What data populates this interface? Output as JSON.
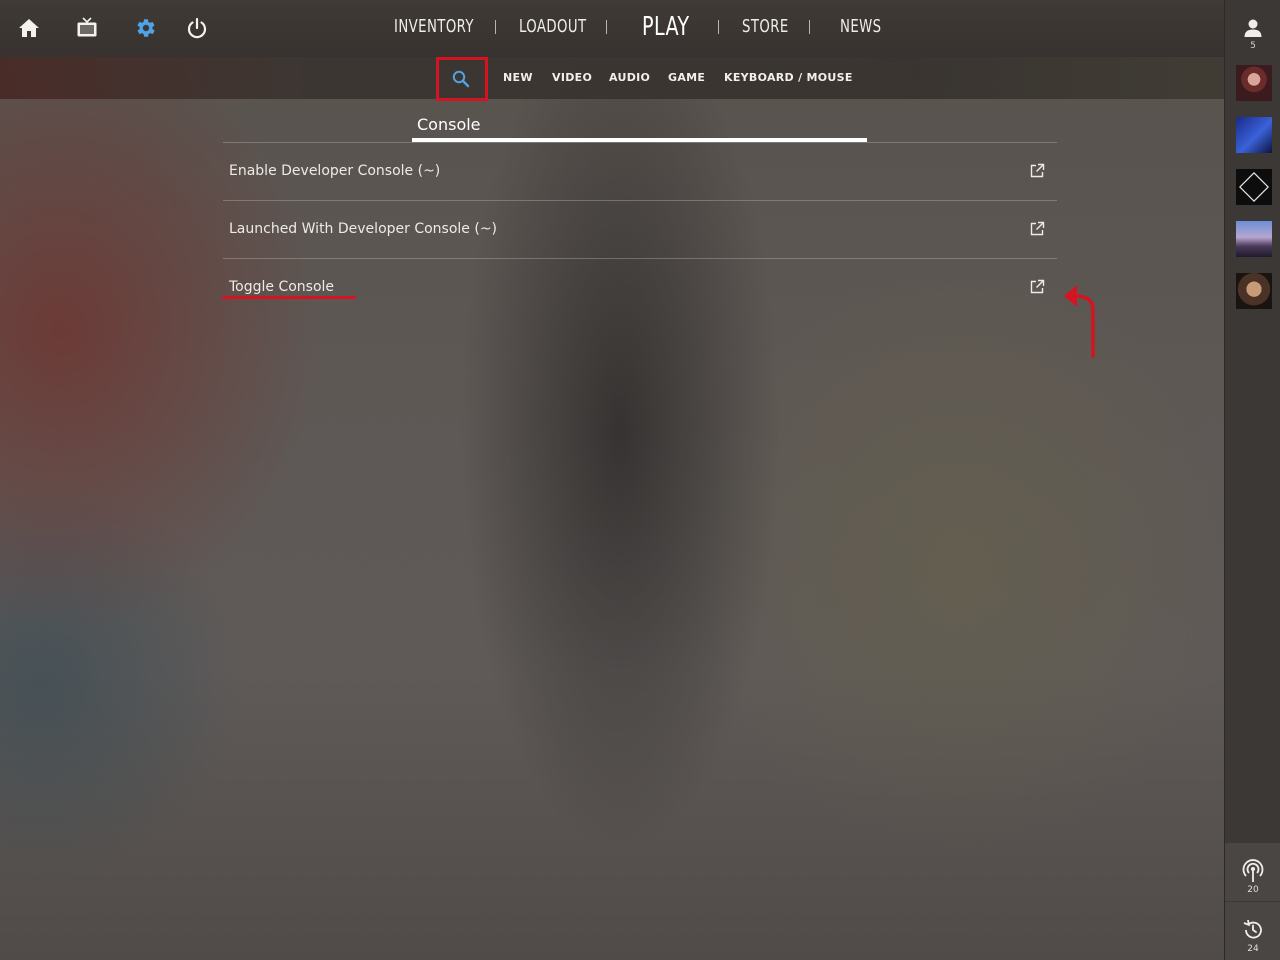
{
  "top_nav": {
    "left_icons": [
      "home-icon",
      "tv-icon",
      "gear-icon",
      "power-icon"
    ],
    "items": [
      "INVENTORY",
      "LOADOUT",
      "PLAY",
      "STORE",
      "NEWS"
    ],
    "active_settings_color": "#4fa3e6"
  },
  "settings_tabs": {
    "search_icon": "search-icon",
    "items": [
      "NEW",
      "VIDEO",
      "AUDIO",
      "GAME",
      "KEYBOARD / MOUSE"
    ]
  },
  "search": {
    "value": "Console"
  },
  "results": [
    {
      "label": "Enable Developer Console (~)",
      "icon": "external-link-icon"
    },
    {
      "label": "Launched With Developer Console (~)",
      "icon": "external-link-icon"
    },
    {
      "label": "Toggle Console",
      "icon": "external-link-icon"
    }
  ],
  "sidebar": {
    "friends_count": "5",
    "avatars": [
      "avatar-1",
      "avatar-2",
      "avatar-3",
      "avatar-4",
      "avatar-5"
    ],
    "broadcast_count": "20",
    "history_count": "24"
  },
  "annotations": {
    "highlight_color": "#d41420"
  }
}
